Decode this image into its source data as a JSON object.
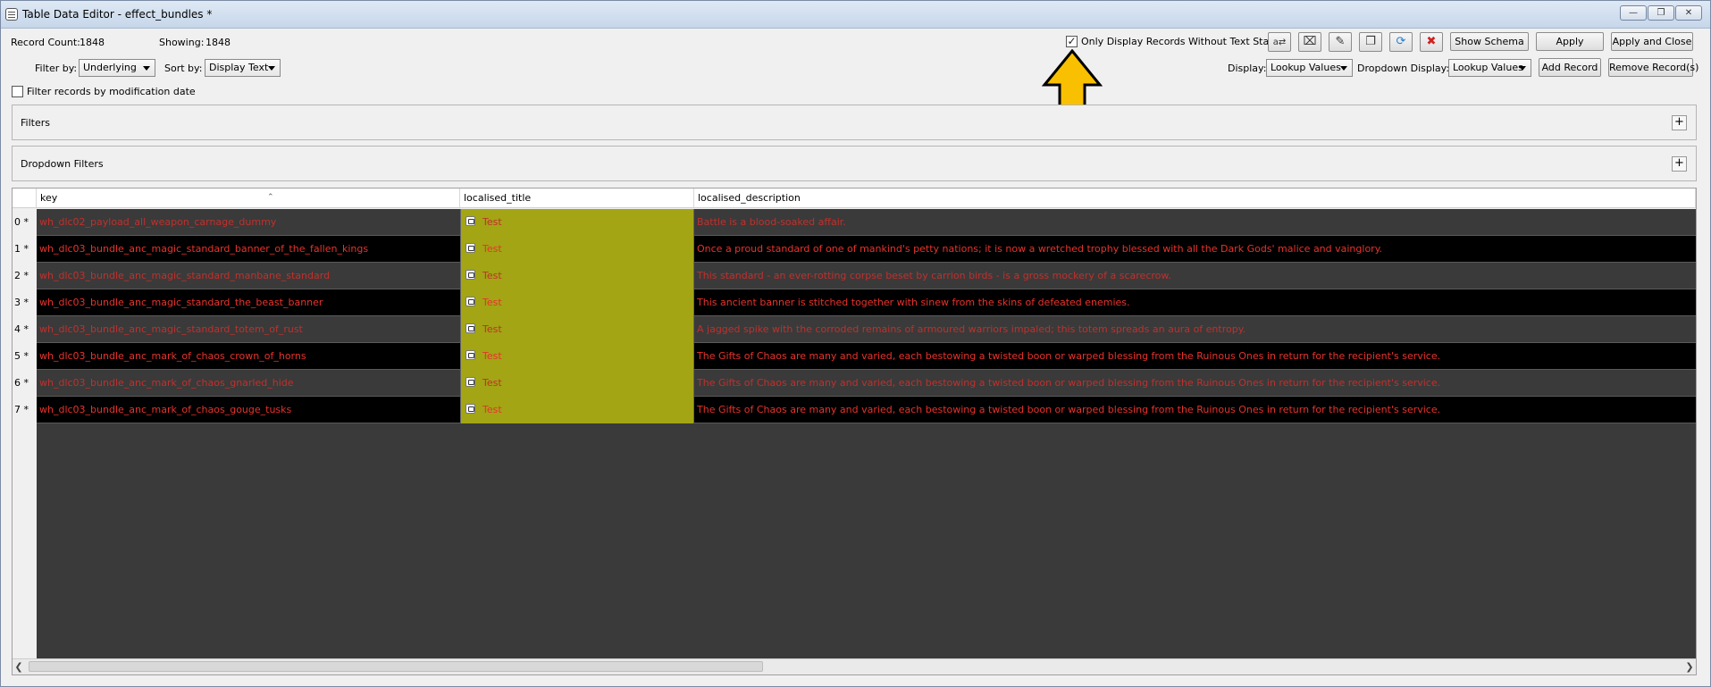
{
  "window": {
    "title": "Table Data Editor - effect_bundles *"
  },
  "stats": {
    "record_count_label": "Record Count:",
    "record_count": "1848",
    "showing_label": "Showing:",
    "showing": "1848"
  },
  "controls": {
    "filter_by_label": "Filter by:",
    "filter_by_value": "Underlying",
    "sort_by_label": "Sort by:",
    "sort_by_value": "Display Text",
    "filter_by_date_label": "Filter records by modification date",
    "only_display_label": "Only Display Records Without Text State",
    "only_display_checked": true,
    "display_label": "Display:",
    "display_value": "Lookup Values",
    "dropdown_display_label": "Dropdown Display:",
    "dropdown_display_value": "Lookup Values"
  },
  "buttons": {
    "show_schema": "Show Schema",
    "apply": "Apply",
    "apply_and_close": "Apply and Close",
    "add_record": "Add Record",
    "remove_records": "Remove Record(s)"
  },
  "toolbar_icons": [
    "translate-icon",
    "clear-icon",
    "edit-icon",
    "copy-icon",
    "refresh-icon",
    "delete-icon"
  ],
  "panels": {
    "filters": "Filters",
    "dropdown_filters": "Dropdown Filters"
  },
  "table": {
    "columns": [
      "key",
      "localised_title",
      "localised_description"
    ],
    "rows": [
      {
        "num": "0 *",
        "key": "wh_dlc02_payload_all_weapon_carnage_dummy",
        "title": "Test",
        "desc": "Battle is a blood-soaked affair."
      },
      {
        "num": "1 *",
        "key": "wh_dlc03_bundle_anc_magic_standard_banner_of_the_fallen_kings",
        "title": "Test",
        "desc": "Once a proud standard of one of mankind's petty nations; it is now a wretched trophy blessed with all the Dark Gods' malice and vainglory."
      },
      {
        "num": "2 *",
        "key": "wh_dlc03_bundle_anc_magic_standard_manbane_standard",
        "title": "Test",
        "desc": "This standard - an ever-rotting corpse beset by carrion birds - is a gross mockery of a scarecrow."
      },
      {
        "num": "3 *",
        "key": "wh_dlc03_bundle_anc_magic_standard_the_beast_banner",
        "title": "Test",
        "desc": "This ancient banner is stitched together with sinew from the skins of defeated enemies."
      },
      {
        "num": "4 *",
        "key": "wh_dlc03_bundle_anc_magic_standard_totem_of_rust",
        "title": "Test",
        "desc": "A jagged spike with the corroded remains of armoured warriors impaled; this totem spreads an aura of entropy."
      },
      {
        "num": "5 *",
        "key": "wh_dlc03_bundle_anc_mark_of_chaos_crown_of_horns",
        "title": "Test",
        "desc": "The Gifts of Chaos are many and varied, each bestowing a twisted boon or warped blessing from the Ruinous Ones in return for the recipient's service."
      },
      {
        "num": "6 *",
        "key": "wh_dlc03_bundle_anc_mark_of_chaos_gnarled_hide",
        "title": "Test",
        "desc": "The Gifts of Chaos are many and varied, each bestowing a twisted boon or warped blessing from the Ruinous Ones in return for the recipient's service."
      },
      {
        "num": "7 *",
        "key": "wh_dlc03_bundle_anc_mark_of_chaos_gouge_tusks",
        "title": "Test",
        "desc": "The Gifts of Chaos are many and varied, each bestowing a twisted boon or warped blessing from the Ruinous Ones in return for the recipient's service."
      }
    ]
  },
  "colors": {
    "title_cell": "#a3a515",
    "text_red": "#e8322c",
    "row_dark": "#000000",
    "row_grey": "#3a3a3a",
    "arrow": "#f8c000"
  }
}
